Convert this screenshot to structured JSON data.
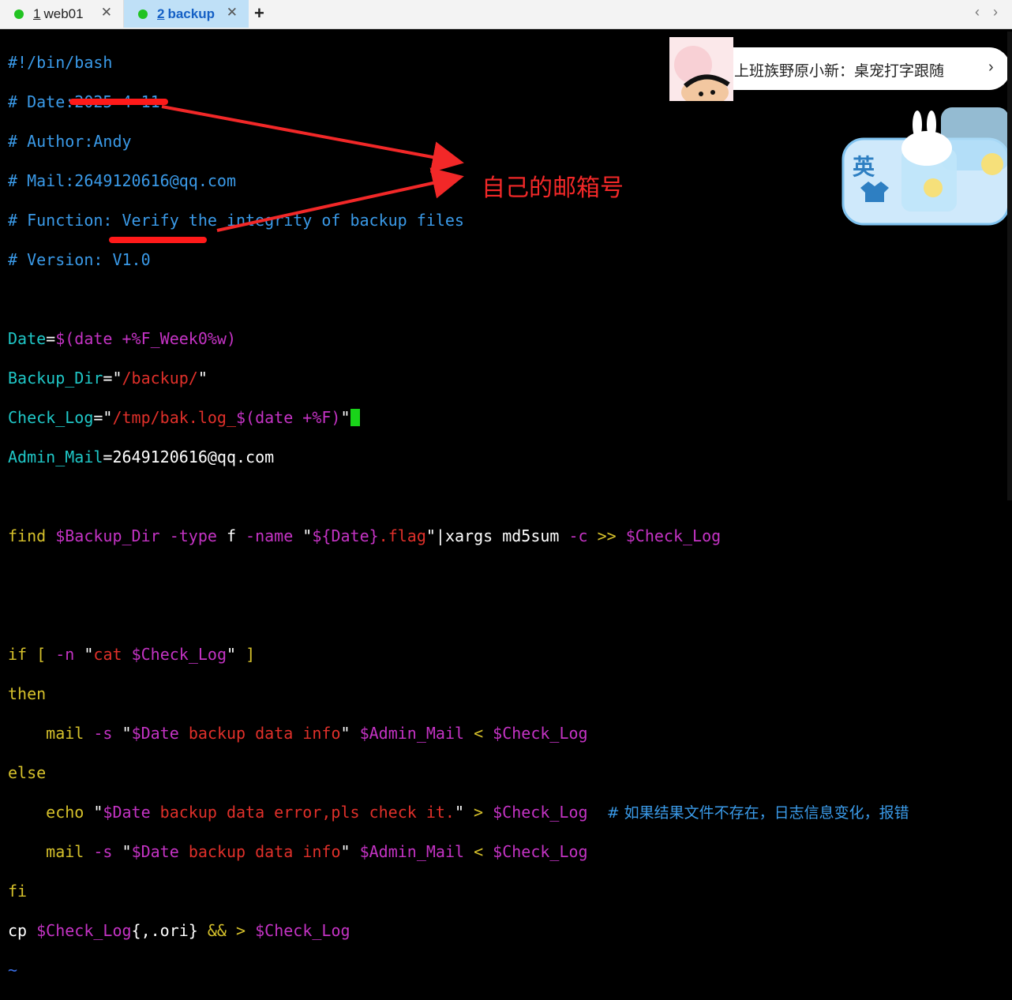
{
  "tabs": [
    {
      "number": "1",
      "label": "web01"
    },
    {
      "number": "2",
      "label": "backup"
    }
  ],
  "tab_close": "✕",
  "new_tab": "+",
  "nav": {
    "prev": "‹",
    "next": "›"
  },
  "code": {
    "l1": "#!/bin/bash",
    "l2": "# Date:2025-4-11",
    "l3": "# Author:Andy",
    "l4": "# Mail:",
    "l4b": "2649120616",
    "l4c": "@qq.com",
    "l5": "# Function: Verify the integrity of backup files",
    "l6": "# Version: V1.0",
    "l8a": "Date",
    "l8b": "=",
    "l8c": "$(date +%F_Week0%w)",
    "l9a": "Backup_Dir",
    "l9b": "=\"",
    "l9c": "/backup/",
    "l9d": "\"",
    "l10a": "Check_Log",
    "l10b": "=\"",
    "l10c": "/tmp/bak.log_",
    "l10d": "$(date +%F)",
    "l10e": "\"",
    "l11a": "Admin_Mail",
    "l11b": "=",
    "l11c": "2649120616",
    "l11d": "@qq.com",
    "l13a": "find ",
    "l13b": "$Backup_Dir",
    "l13c": " -type",
    "l13d": " f ",
    "l13e": "-name",
    "l13f": " \"",
    "l13g": "${Date}",
    "l13h": ".flag",
    "l13i": "\"",
    "l13j": "|xargs md5sum ",
    "l13k": "-c",
    "l13l": " >> ",
    "l13m": "$Check_Log",
    "l16a": "if",
    "l16b": " [ ",
    "l16c": "-n",
    "l16d": " \"",
    "l16e": "cat ",
    "l16f": "$Check_Log",
    "l16g": "\"",
    "l16h": " ]",
    "l17": "then",
    "l18a": "    mail ",
    "l18b": "-s",
    "l18c": " \"",
    "l18d": "$Date",
    "l18e": " backup data info",
    "l18f": "\"",
    "l18g": " $Admin_Mail",
    "l18h": " < ",
    "l18i": "$Check_Log",
    "l19": "else",
    "l20a": "    echo ",
    "l20b": "\"",
    "l20c": "$Date",
    "l20d": " backup data error,pls check it.",
    "l20e": "\"",
    "l20f": " > ",
    "l20g": "$Check_Log",
    "l20h": "    # 如果结果文件不存在，日志信息变化，报错",
    "l21a": "    mail ",
    "l21b": "-s",
    "l21c": " \"",
    "l21d": "$Date",
    "l21e": " backup data info",
    "l21f": "\"",
    "l21g": " $Admin_Mail",
    "l21h": " < ",
    "l21i": "$Check_Log",
    "l22": "fi",
    "l23a": "cp ",
    "l23b": "$Check_Log",
    "l23c": "{,.ori}",
    "l23d": " && ",
    "l23e": "> ",
    "l23f": "$Check_Log",
    "l24": "~"
  },
  "annotation": "自己的邮箱号",
  "popup": {
    "text": "上班族野原小新：桌宠打字跟随",
    "chevron": "›"
  },
  "ime": {
    "label": "英"
  },
  "colors": {
    "comment": "#3a9ae8",
    "variable": "#1fc7c7",
    "string": "#e0302a",
    "keyword": "#d6c12b",
    "special": "#c433c4",
    "arrow": "#f22828",
    "cursor": "#19d419",
    "active_tab": "#bfe0f7"
  }
}
